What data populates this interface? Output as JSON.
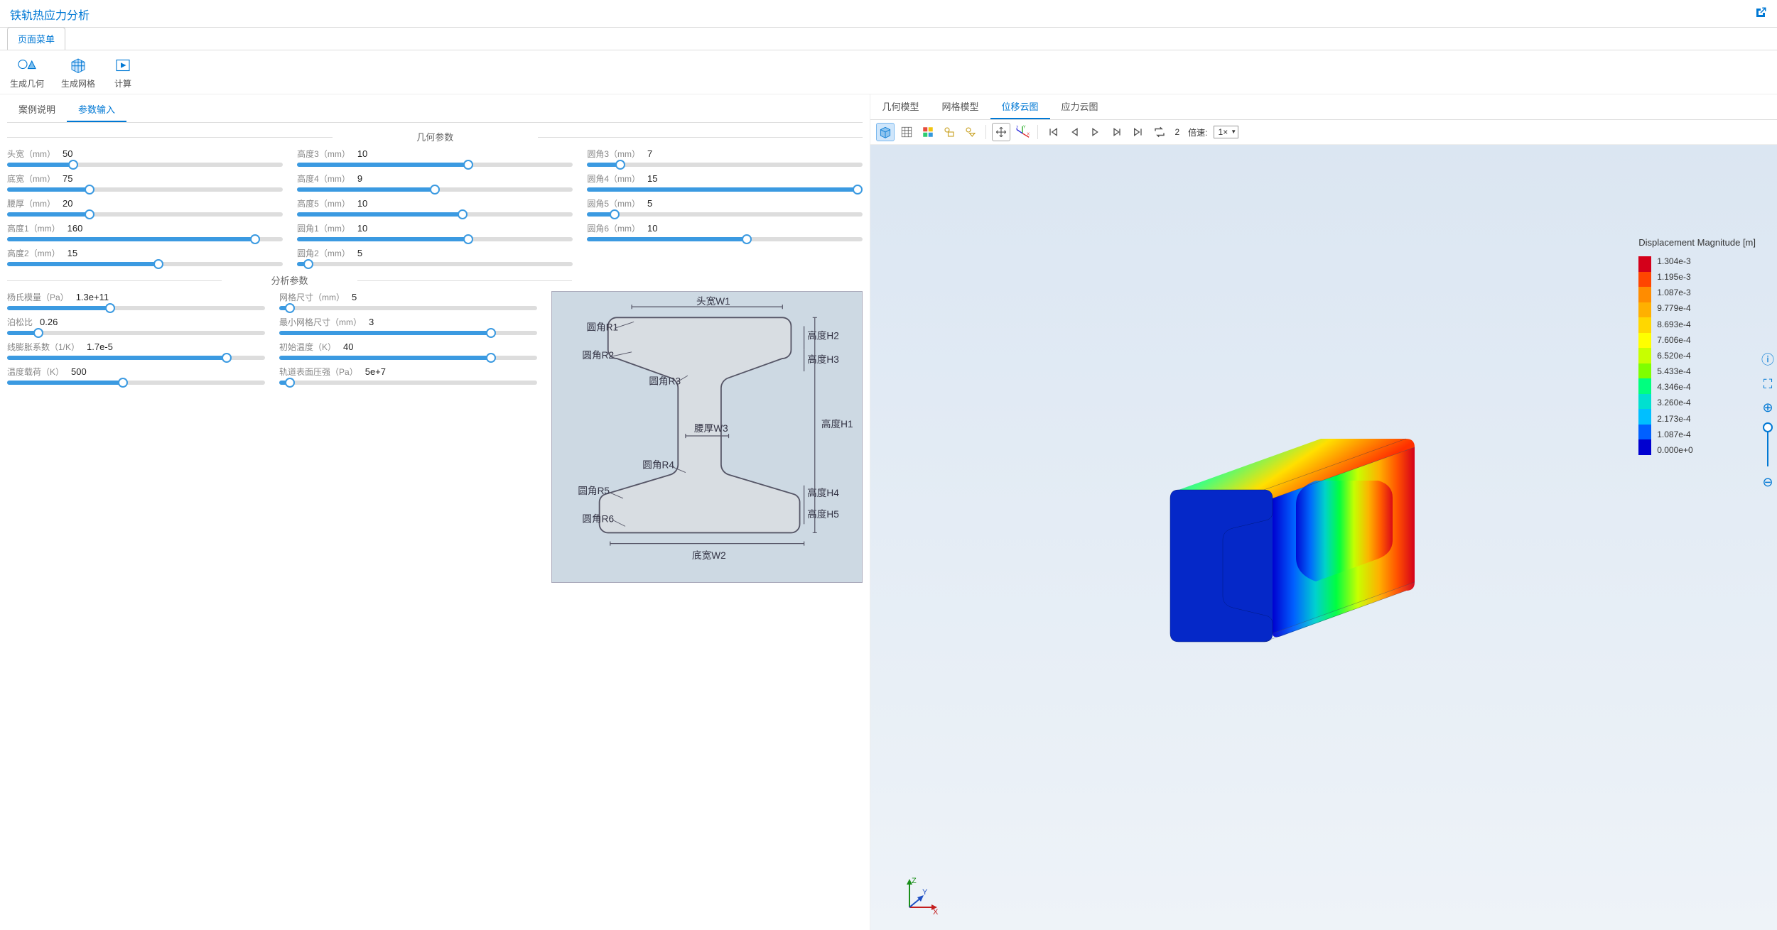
{
  "header": {
    "title": "铁轨热应力分析"
  },
  "page_menu": "页面菜单",
  "toolbar": [
    {
      "id": "gen-geom",
      "label": "生成几何"
    },
    {
      "id": "gen-mesh",
      "label": "生成网格"
    },
    {
      "id": "compute",
      "label": "计算"
    }
  ],
  "left_tabs": [
    {
      "id": "case-desc",
      "label": "案例说明",
      "active": false
    },
    {
      "id": "param-in",
      "label": "参数输入",
      "active": true
    }
  ],
  "sections": {
    "geom": "几何参数",
    "analysis": "分析参数"
  },
  "params_geom": [
    {
      "label": "头宽（mm）",
      "value": "50",
      "pct": 24
    },
    {
      "label": "高度3（mm）",
      "value": "10",
      "pct": 62
    },
    {
      "label": "圆角3（mm）",
      "value": "7",
      "pct": 12
    },
    {
      "label": "底宽（mm）",
      "value": "75",
      "pct": 30
    },
    {
      "label": "高度4（mm）",
      "value": "9",
      "pct": 50
    },
    {
      "label": "圆角4（mm）",
      "value": "15",
      "pct": 98
    },
    {
      "label": "腰厚（mm）",
      "value": "20",
      "pct": 30
    },
    {
      "label": "高度5（mm）",
      "value": "10",
      "pct": 60
    },
    {
      "label": "圆角5（mm）",
      "value": "5",
      "pct": 10
    },
    {
      "label": "高度1（mm）",
      "value": "160",
      "pct": 90
    },
    {
      "label": "圆角1（mm）",
      "value": "10",
      "pct": 62
    },
    {
      "label": "圆角6（mm）",
      "value": "10",
      "pct": 58
    },
    {
      "label": "高度2（mm）",
      "value": "15",
      "pct": 55
    },
    {
      "label": "圆角2（mm）",
      "value": "5",
      "pct": 4
    }
  ],
  "params_analysis": [
    {
      "label": "杨氏模量（Pa）",
      "value": "1.3e+11",
      "pct": 40
    },
    {
      "label": "网格尺寸（mm）",
      "value": "5",
      "pct": 4
    },
    {
      "label": "泊松比",
      "value": "0.26",
      "pct": 12
    },
    {
      "label": "最小网格尺寸（mm）",
      "value": "3",
      "pct": 82
    },
    {
      "label": "线膨胀系数（1/K）",
      "value": "1.7e-5",
      "pct": 85
    },
    {
      "label": "初始温度（K）",
      "value": "40",
      "pct": 82
    },
    {
      "label": "温度载荷（K）",
      "value": "500",
      "pct": 45
    },
    {
      "label": "轨道表面压强（Pa）",
      "value": "5e+7",
      "pct": 4
    }
  ],
  "diagram_labels": {
    "w1": "头宽W1",
    "w2": "底宽W2",
    "w3": "腰厚W3",
    "h1": "高度H1",
    "h2": "高度H2",
    "h3": "高度H3",
    "h4": "高度H4",
    "h5": "高度H5",
    "r1": "圆角R1",
    "r2": "圆角R2",
    "r3": "圆角R3",
    "r4": "圆角R4",
    "r5": "圆角R5",
    "r6": "圆角R6"
  },
  "right_tabs": [
    {
      "id": "geom-model",
      "label": "几何模型",
      "active": false
    },
    {
      "id": "mesh-model",
      "label": "网格模型",
      "active": false
    },
    {
      "id": "disp-cloud",
      "label": "位移云图",
      "active": true
    },
    {
      "id": "stress-cloud",
      "label": "应力云图",
      "active": false
    }
  ],
  "viewer_toolbar": {
    "frame": "2",
    "speed_label": "倍速:",
    "speed_value": "1×"
  },
  "legend": {
    "title": "Displacement Magnitude [m]",
    "values": [
      "1.304e-3",
      "1.195e-3",
      "1.087e-3",
      "9.779e-4",
      "8.693e-4",
      "7.606e-4",
      "6.520e-4",
      "5.433e-4",
      "4.346e-4",
      "3.260e-4",
      "2.173e-4",
      "1.087e-4",
      "0.000e+0"
    ],
    "colors": [
      "#d4001a",
      "#ff4500",
      "#ff8c00",
      "#ffb000",
      "#ffd700",
      "#ffff00",
      "#c8ff00",
      "#7fff00",
      "#00ff7f",
      "#00e0d0",
      "#00bfff",
      "#0060ff",
      "#0000d0"
    ]
  },
  "triad": {
    "x": "X",
    "y": "Y",
    "z": "Z"
  }
}
